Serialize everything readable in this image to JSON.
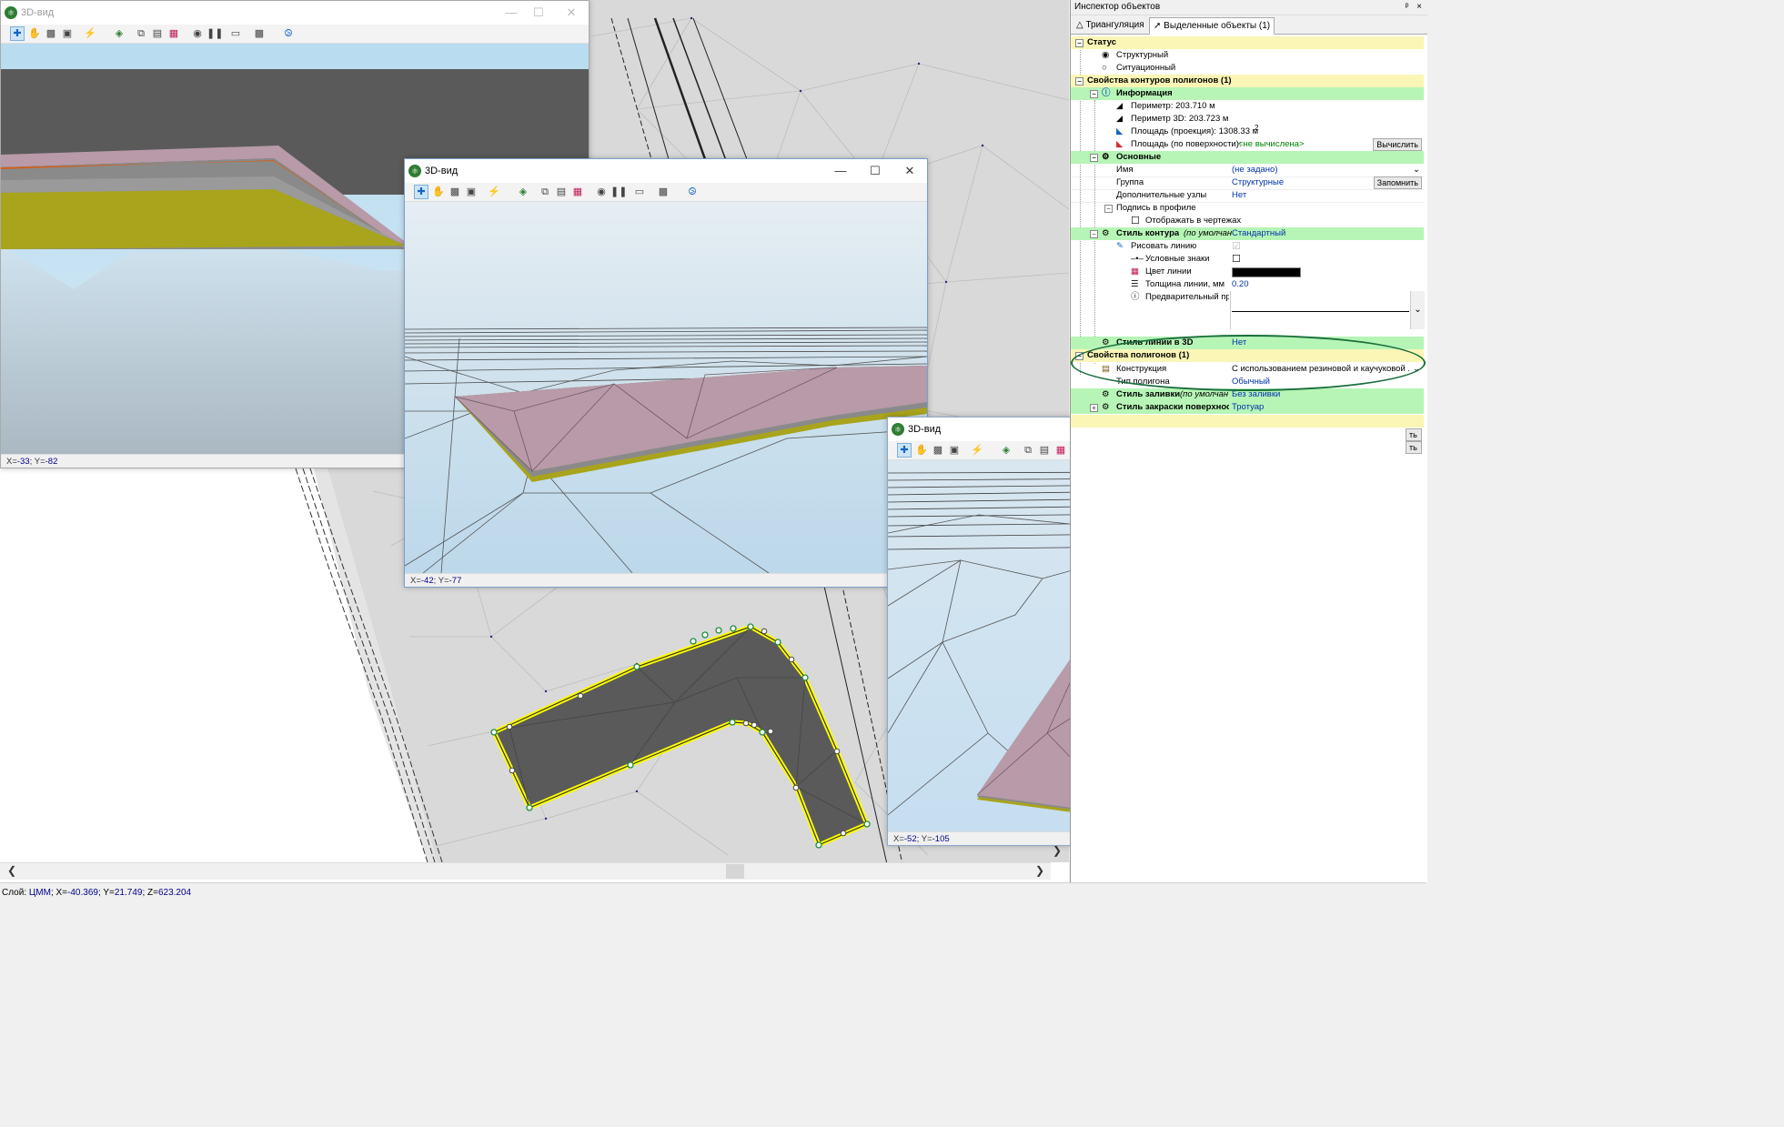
{
  "status_bar": {
    "layer_label": "Слой:",
    "layer_value": "ЦММ",
    "x_label": "X=",
    "x_value": "-40.369",
    "y_label": "Y=",
    "y_value": "21.749",
    "z_label": "Z=",
    "z_value": "623.204"
  },
  "windows": {
    "w1": {
      "title": "3D-вид",
      "coords_x": "-33",
      "coords_y": "-82"
    },
    "w2": {
      "title": "3D-вид",
      "coords_x": "-42",
      "coords_y": "-77"
    },
    "w3": {
      "title": "3D-вид",
      "coords_x": "-52",
      "coords_y": "-105"
    }
  },
  "window_buttons": {
    "minimize": "—",
    "maximize": "☐",
    "close": "✕"
  },
  "toolbar_icons": [
    "select-icon",
    "pan-icon",
    "camera-icon",
    "car-icon",
    "flash-icon",
    "palette-icon",
    "copy-icon",
    "save-view-icon",
    "layers-icon",
    "record-icon",
    "pause-icon",
    "monitor-icon",
    "export-icon",
    "compass-icon"
  ],
  "inspector": {
    "title": "Инспектор объектов",
    "pin": "ᵖ",
    "close": "×",
    "tabs": [
      "Триангуляция",
      "Выделенные объекты (1)"
    ],
    "rows": {
      "status": "Статус",
      "structural": "Структурный",
      "situational": "Ситуационный",
      "contour_props": "Свойства контуров полигонов (1)",
      "info": "Информация",
      "perimeter": "Периметр: 203.710 м",
      "perimeter3d": "Периметр 3D: 203.723 м",
      "area_proj": "Площадь (проекция): 1308.33 м",
      "area_sup": "2",
      "area_surf": "Площадь (по поверхности):",
      "area_surf_val": "<не вычислена>",
      "calc_btn": "Вычислить",
      "basic": "Основные",
      "name": "Имя",
      "name_val": "(не задано)",
      "group": "Группа",
      "group_val": "Структурные",
      "remember_btn": "Запомнить",
      "extra_nodes": "Дополнительные узлы",
      "extra_nodes_val": "Нет",
      "profile_caption": "Подпись в профиле",
      "show_drawings": "Отображать в чертежах",
      "contour_style": "Стиль контура",
      "contour_style_hint": "(по умолчан",
      "contour_style_val": "Стандартный",
      "draw_line": "Рисовать линию",
      "symbols": "Условные знаки",
      "line_color": "Цвет линии",
      "line_width": "Толщина линии, мм",
      "line_width_val": "0.20",
      "preview": "Предварительный про",
      "line_style3d": "Стиль линии в 3D",
      "line_style3d_val": "Нет",
      "polygon_props": "Свойства полигонов (1)",
      "construction": "Конструкция",
      "construction_val": "С использованием резиновой и каучуковой ...",
      "polygon_type": "Тип полигона",
      "polygon_type_val": "Обычный",
      "fill_style": "Стиль заливки",
      "fill_style_hint": "(по умолчан",
      "fill_style_val": "Без заливки",
      "surface_style": "Стиль закраски поверхнос",
      "surface_style_val": "Тротуар",
      "btn_tail_1": "ть",
      "btn_tail_2": "ть"
    }
  },
  "colors": {
    "accent": "#1565c0",
    "header_yellow": "#fbf6b6",
    "header_green": "#b6f5b6",
    "polygon_pink": "#b89aa8",
    "layer_yellow": "#a8a41c",
    "selection_yellow": "#ffff00",
    "highlight_ellipse": "#1b6e3c"
  }
}
